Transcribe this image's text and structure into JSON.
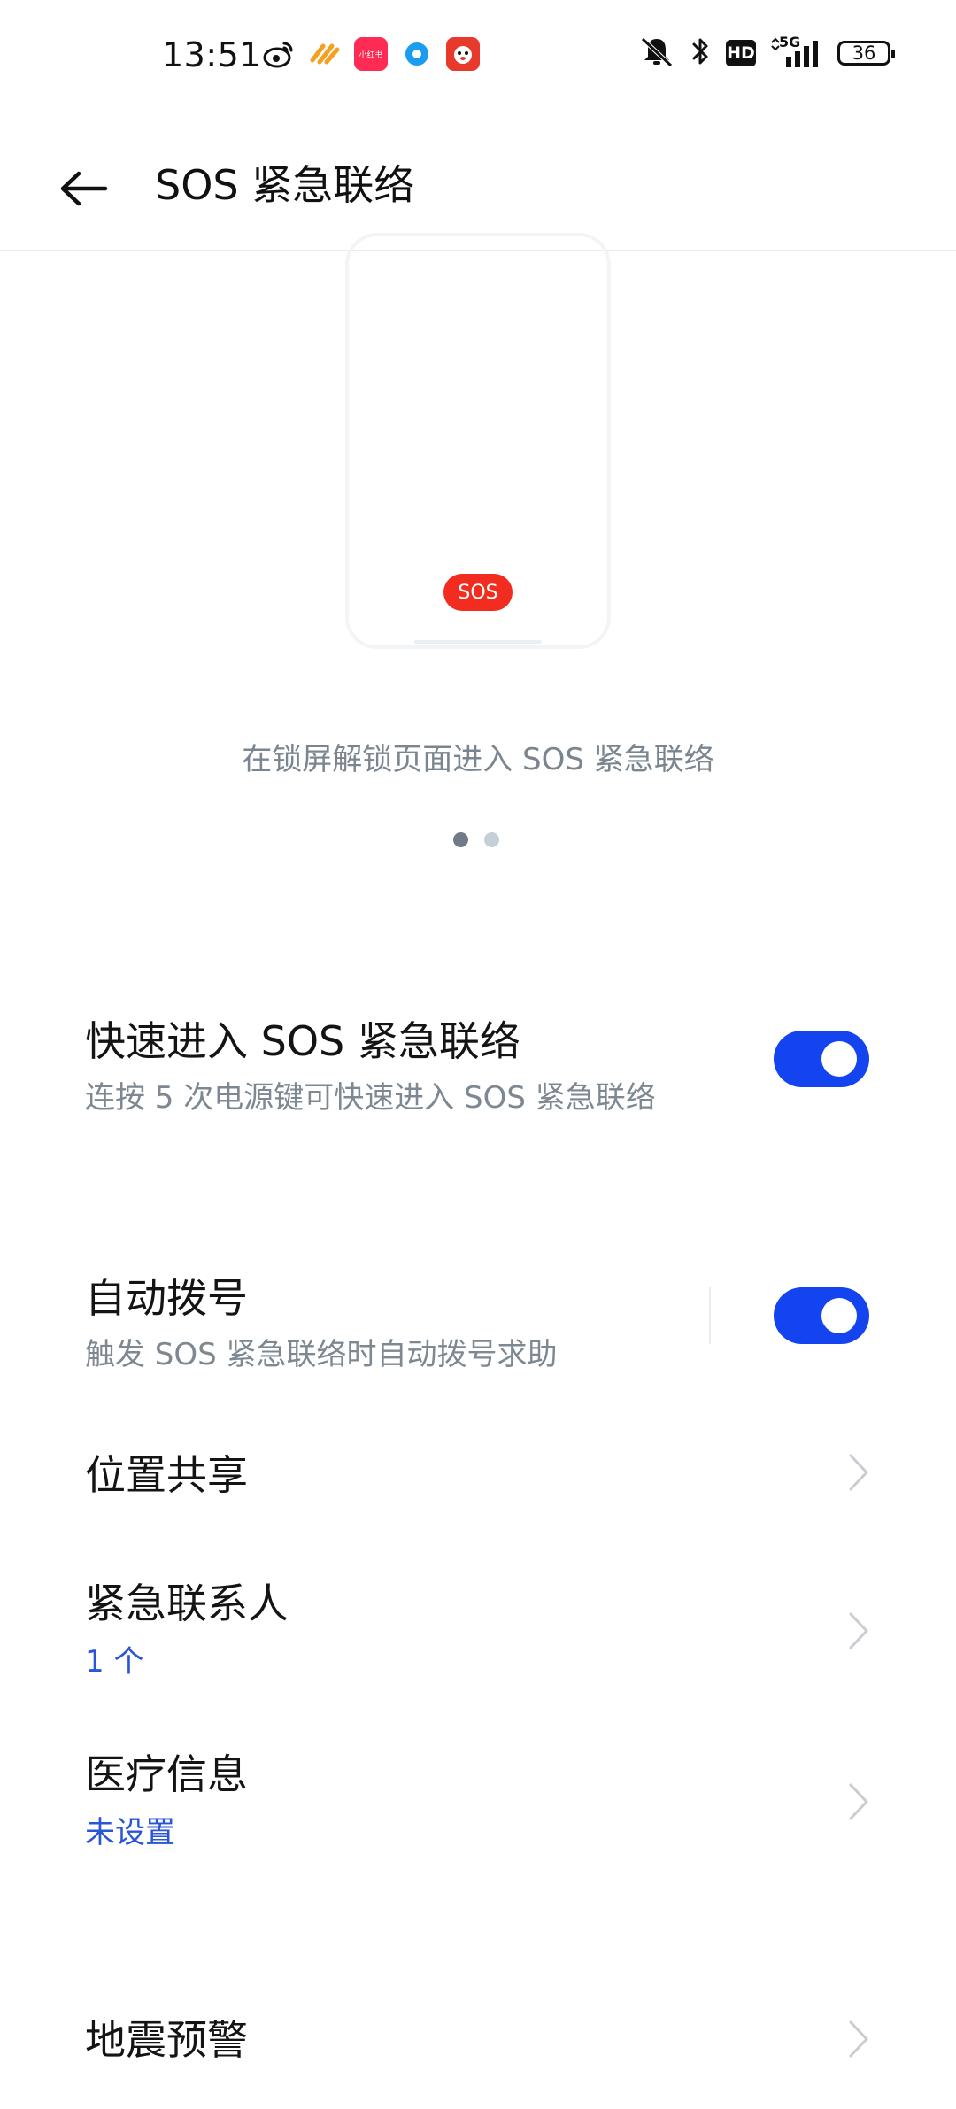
{
  "status_bar": {
    "time": "13:51",
    "notification_icons": [
      "weibo-icon",
      "taobao-special-icon",
      "xiaohongshu-icon",
      "qq-browser-icon",
      "jd-icon"
    ],
    "xiaohongshu_label": "小红书",
    "hd_label": "HD",
    "network_label": "5G",
    "battery_level": "36",
    "colors": {
      "weibo": "#111111",
      "taobao_special": "#f5a020",
      "xiaohongshu": "#fe2c55",
      "qq_browser": "#1a9cf0",
      "jd": "#e83a2c"
    }
  },
  "header": {
    "back_icon": "arrow-left-icon",
    "title": "SOS 紧急联络"
  },
  "illustration": {
    "sos_label": "SOS",
    "caption": "在锁屏解锁页面进入 SOS 紧急联络",
    "page_count": 2,
    "active_page": 1
  },
  "settings": {
    "quick_sos": {
      "title": "快速进入 SOS 紧急联络",
      "subtitle": "连按 5 次电源键可快速进入 SOS 紧急联络",
      "enabled": true
    },
    "auto_dial": {
      "title": "自动拨号",
      "subtitle": "触发 SOS 紧急联络时自动拨号求助",
      "enabled": true
    },
    "location_share": {
      "title": "位置共享"
    },
    "emergency_contacts": {
      "title": "紧急联系人",
      "value": "1 个"
    },
    "medical_info": {
      "title": "医疗信息",
      "value": "未设置"
    },
    "earthquake_warning": {
      "title": "地震预警"
    }
  },
  "theme": {
    "accent": "#1444ef",
    "sos_red": "#f22d20",
    "link_blue": "#2a56d6"
  }
}
